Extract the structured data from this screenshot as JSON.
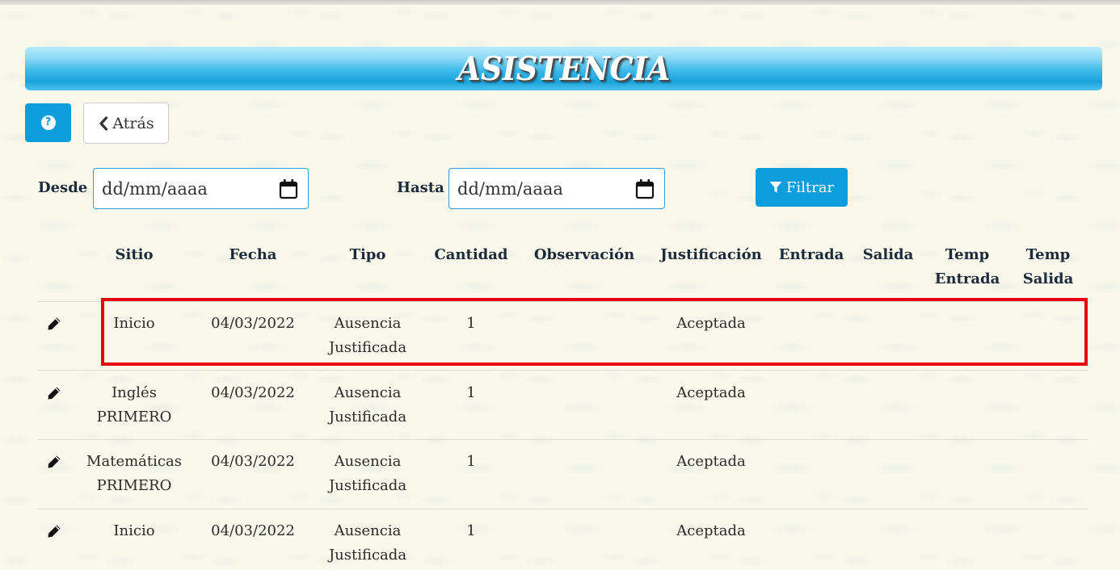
{
  "header": {
    "title": "ASISTENCIA"
  },
  "toolbar": {
    "back_label": "Atrás",
    "help_icon": "question-circle-icon"
  },
  "filters": {
    "from_label": "Desde",
    "from_value": "dd/mm/aaaa",
    "to_label": "Hasta",
    "to_value": "dd/mm/aaaa",
    "filter_label": "Filtrar"
  },
  "table": {
    "columns": [
      [
        "Sitio"
      ],
      [
        "Fecha"
      ],
      [
        "Tipo"
      ],
      [
        "Cantidad"
      ],
      [
        "Observación"
      ],
      [
        "Justificación"
      ],
      [
        "Entrada"
      ],
      [
        "Salida"
      ],
      [
        "Temp",
        "Entrada"
      ],
      [
        "Temp",
        "Salida"
      ]
    ],
    "rows": [
      {
        "sitio": [
          "Inicio"
        ],
        "fecha": "04/03/2022",
        "tipo": [
          "Ausencia",
          "Justificada"
        ],
        "cantidad": "1",
        "observacion": "",
        "justificacion": "Aceptada",
        "entrada": "",
        "salida": "",
        "temp_entrada": "",
        "temp_salida": ""
      },
      {
        "sitio": [
          "Inglés",
          "PRIMERO"
        ],
        "fecha": "04/03/2022",
        "tipo": [
          "Ausencia",
          "Justificada"
        ],
        "cantidad": "1",
        "observacion": "",
        "justificacion": "Aceptada",
        "entrada": "",
        "salida": "",
        "temp_entrada": "",
        "temp_salida": ""
      },
      {
        "sitio": [
          "Matemáticas",
          "PRIMERO"
        ],
        "fecha": "04/03/2022",
        "tipo": [
          "Ausencia",
          "Justificada"
        ],
        "cantidad": "1",
        "observacion": "",
        "justificacion": "Aceptada",
        "entrada": "",
        "salida": "",
        "temp_entrada": "",
        "temp_salida": ""
      },
      {
        "sitio": [
          "Inicio"
        ],
        "fecha": "04/03/2022",
        "tipo": [
          "Ausencia",
          "Justificada"
        ],
        "cantidad": "1",
        "observacion": "",
        "justificacion": "Aceptada",
        "entrada": "",
        "salida": "",
        "temp_entrada": "",
        "temp_salida": ""
      }
    ]
  },
  "colors": {
    "accent": "#0d9cdc",
    "highlight": "#e8000b",
    "background": "#f9f8ea"
  }
}
